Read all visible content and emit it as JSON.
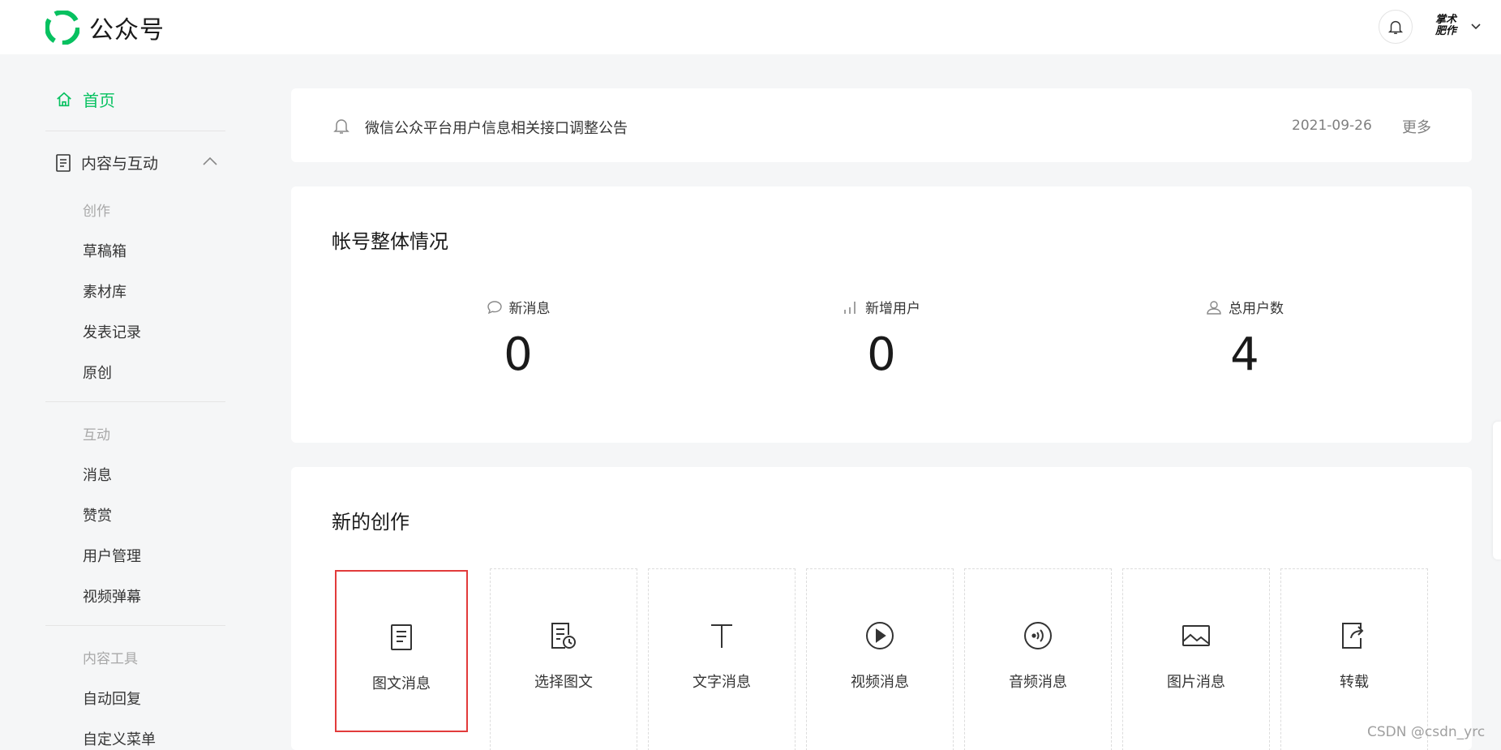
{
  "header": {
    "app_name": "公众号",
    "avatar_text": "掌术肥作"
  },
  "sidebar": {
    "home_label": "首页",
    "group_label": "内容与互动",
    "sections": [
      {
        "title": "创作",
        "items": [
          "草稿箱",
          "素材库",
          "发表记录",
          "原创"
        ]
      },
      {
        "title": "互动",
        "items": [
          "消息",
          "赞赏",
          "用户管理",
          "视频弹幕"
        ]
      },
      {
        "title": "内容工具",
        "items": [
          "自动回复",
          "自定义菜单"
        ]
      }
    ]
  },
  "notice": {
    "text": "微信公众平台用户信息相关接口调整公告",
    "date": "2021-09-26",
    "more": "更多"
  },
  "overview": {
    "title": "帐号整体情况",
    "stats": [
      {
        "label": "新消息",
        "value": "0"
      },
      {
        "label": "新增用户",
        "value": "0"
      },
      {
        "label": "总用户数",
        "value": "4"
      }
    ]
  },
  "create": {
    "title": "新的创作",
    "tiles": [
      "图文消息",
      "选择图文",
      "文字消息",
      "视频消息",
      "音频消息",
      "图片消息",
      "转载"
    ]
  },
  "watermark": "CSDN @csdn_yrc",
  "colors": {
    "accent": "#07c160",
    "highlight": "#e23b3b"
  }
}
